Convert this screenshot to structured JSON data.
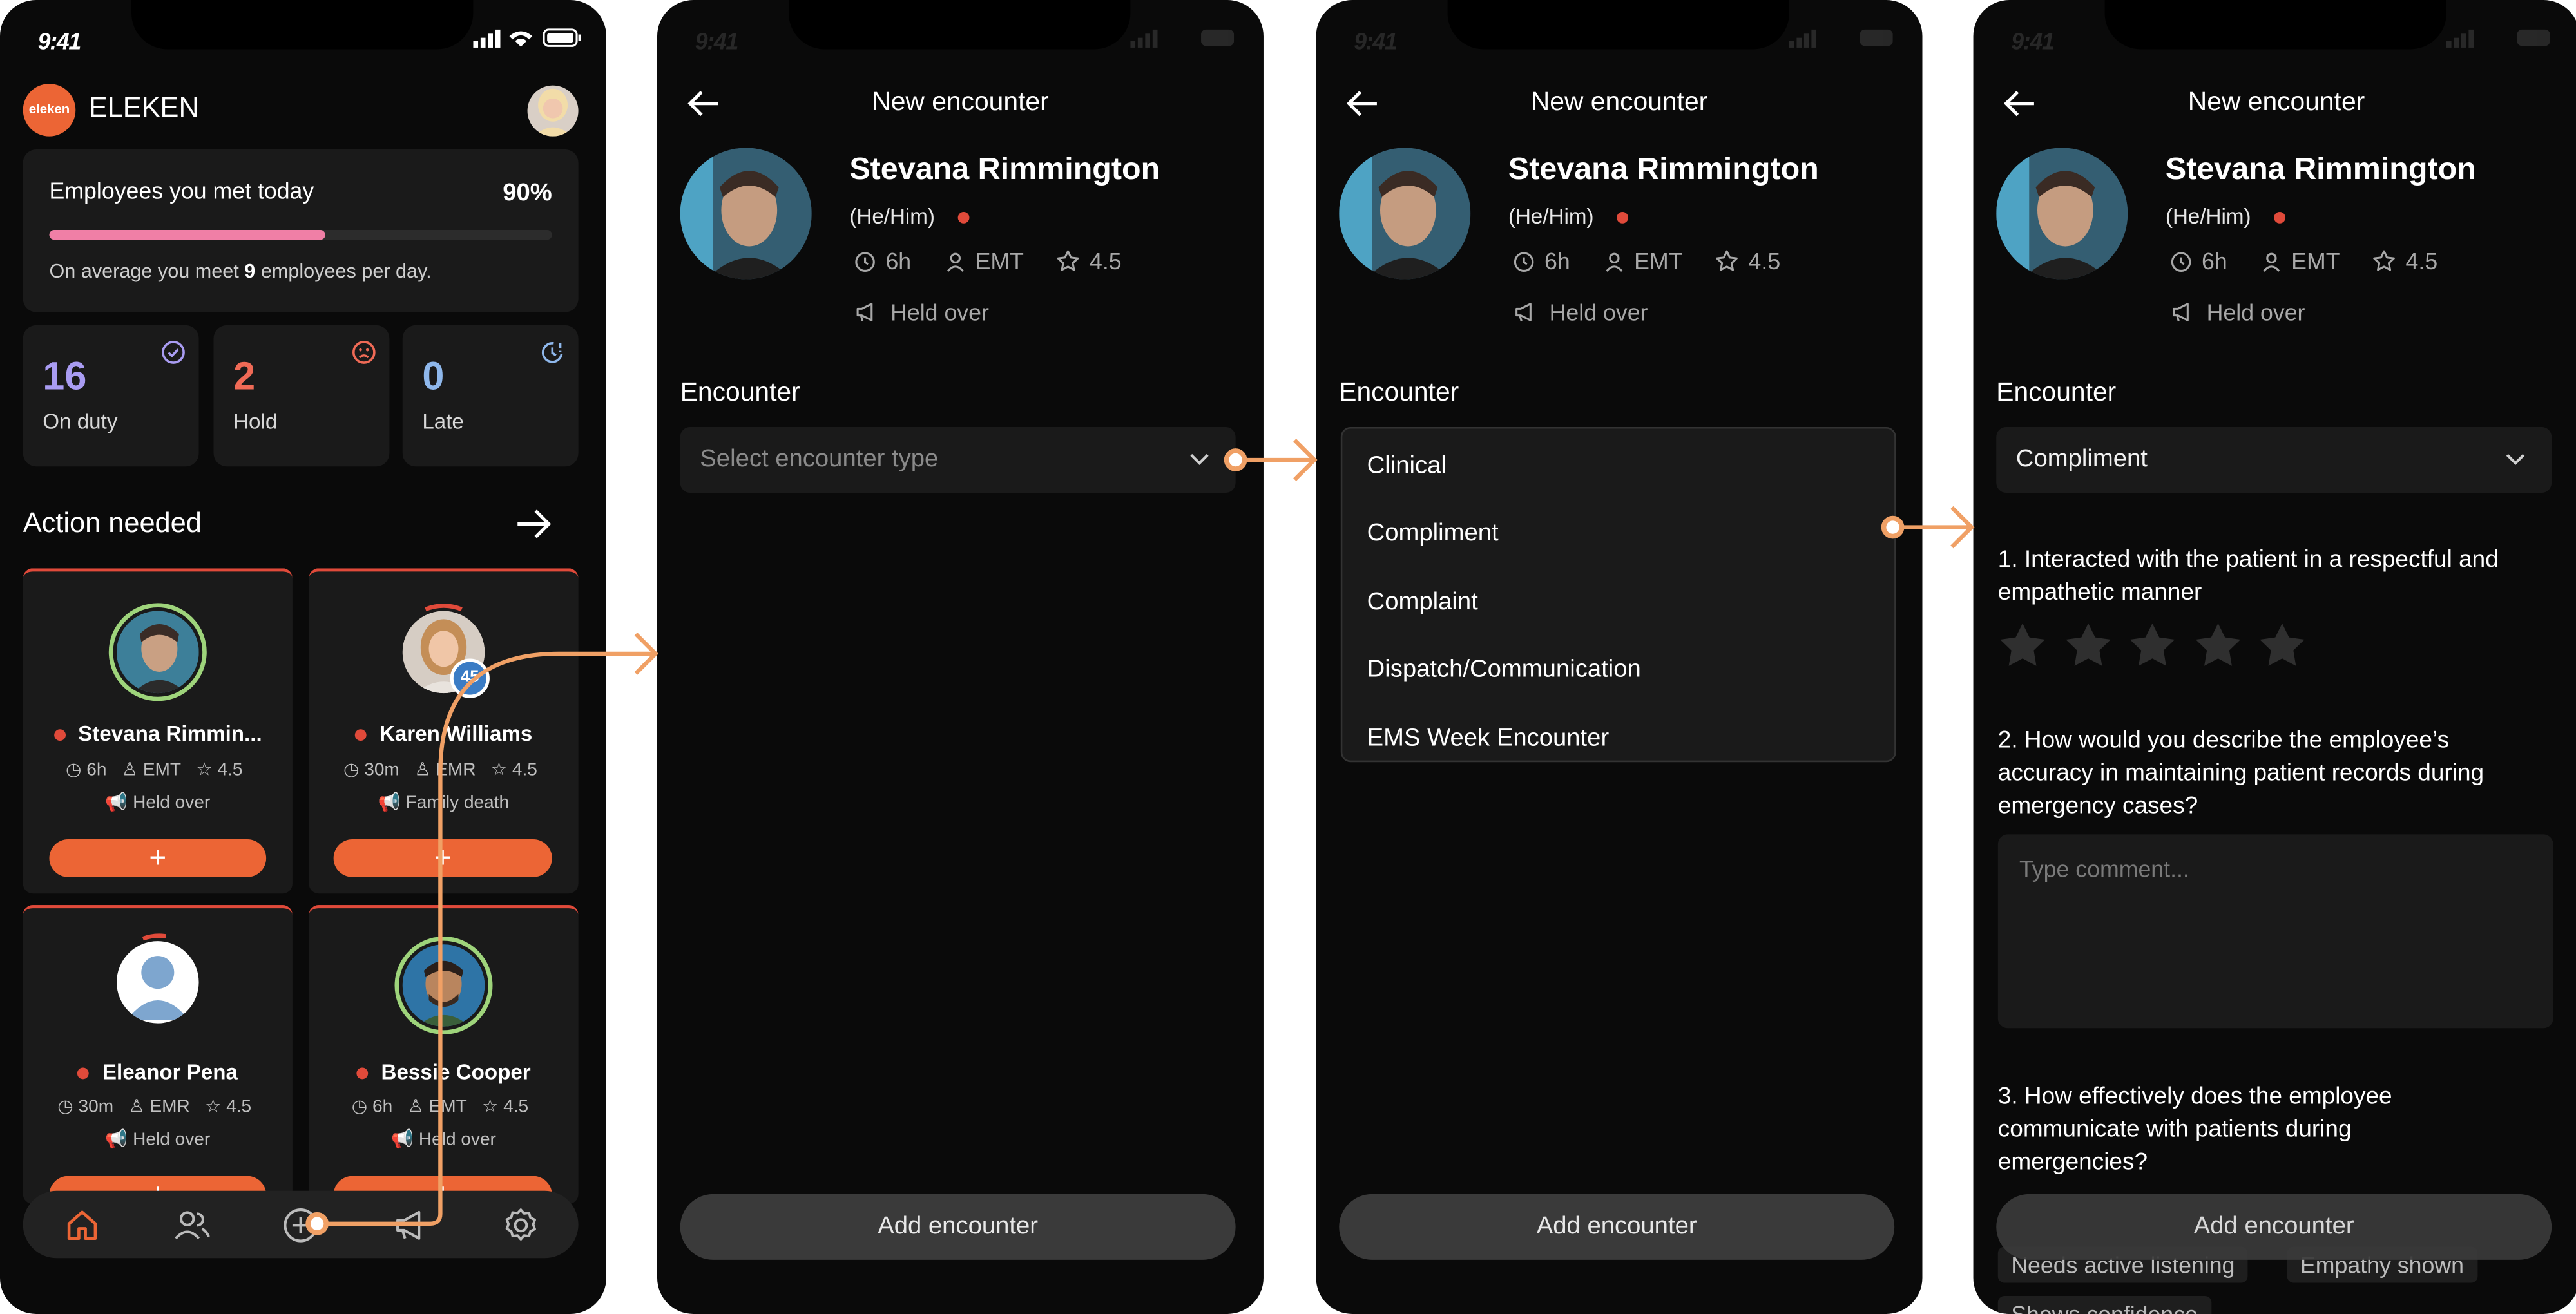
{
  "status_bar": {
    "time": "9:41"
  },
  "screen1": {
    "brand": {
      "logo_text": "eleken",
      "name": "ELEKEN"
    },
    "met_today": {
      "title": "Employees you met today",
      "percent": "90%",
      "progress": 0.55,
      "avg_prefix": "On average you meet ",
      "avg_count": "9",
      "avg_suffix": " employees per day."
    },
    "stats": [
      {
        "value": "16",
        "label": "On duty",
        "color": "#a99cf2",
        "icon": "check-circle-icon"
      },
      {
        "value": "2",
        "label": "Hold",
        "color": "#ef6a56",
        "icon": "sad-face-icon"
      },
      {
        "value": "0",
        "label": "Late",
        "color": "#8fb8ec",
        "icon": "clock-alert-icon"
      }
    ],
    "action_title": "Action needed",
    "employees": [
      {
        "name": "Stevana Rimmin...",
        "duration": "6h",
        "role": "EMT",
        "rating": "4.5",
        "note": "Held over",
        "ring_color": "#9ed47b"
      },
      {
        "name": "Karen Williams",
        "duration": "30m",
        "role": "EMR",
        "rating": "4.5",
        "note": "Family death",
        "badge": "45",
        "ring_color": "#e04a3a"
      },
      {
        "name": "Eleanor Pena",
        "duration": "30m",
        "role": "EMR",
        "rating": "4.5",
        "note": "Held over",
        "ring_color": "#e04a3a"
      },
      {
        "name": "Bessie Cooper",
        "duration": "6h",
        "role": "EMT",
        "rating": "4.5",
        "note": "Held over",
        "ring_color": "#9ed47b"
      }
    ],
    "add_symbol": "+",
    "nav": [
      {
        "name": "home-icon",
        "active": true
      },
      {
        "name": "people-icon",
        "active": false
      },
      {
        "name": "add-circle-icon",
        "active": false
      },
      {
        "name": "megaphone-icon",
        "active": false
      },
      {
        "name": "settings-icon",
        "active": false
      }
    ]
  },
  "encounter": {
    "title": "New encounter",
    "name": "Stevana Rimmington",
    "pronouns": "(He/Him)",
    "duration": "6h",
    "role": "EMT",
    "rating": "4.5",
    "status": "Held over",
    "section_label": "Encounter",
    "select_placeholder": "Select encounter type",
    "options": [
      "Clinical",
      "Compliment",
      "Complaint",
      "Dispatch/Communication",
      "EMS Week Encounter"
    ],
    "selected": "Compliment",
    "q1": "1. Interacted with the patient in a respectful and empathetic manner",
    "q1_rating": 0,
    "q2": "2. How would you describe the employee’s accuracy in maintaining patient records during emergency cases?",
    "comment_placeholder": "Type comment...",
    "q3": "3.  How effectively does the employee communicate with patients during emergencies?",
    "tags": [
      "Needs active listening",
      "Empathy shown",
      "Shows confidence"
    ],
    "add_button": "Add encounter"
  },
  "colors": {
    "accent": "#ec6535",
    "background": "#0a0a0a",
    "card": "#1a1a1a",
    "danger": "#e04a3a"
  }
}
